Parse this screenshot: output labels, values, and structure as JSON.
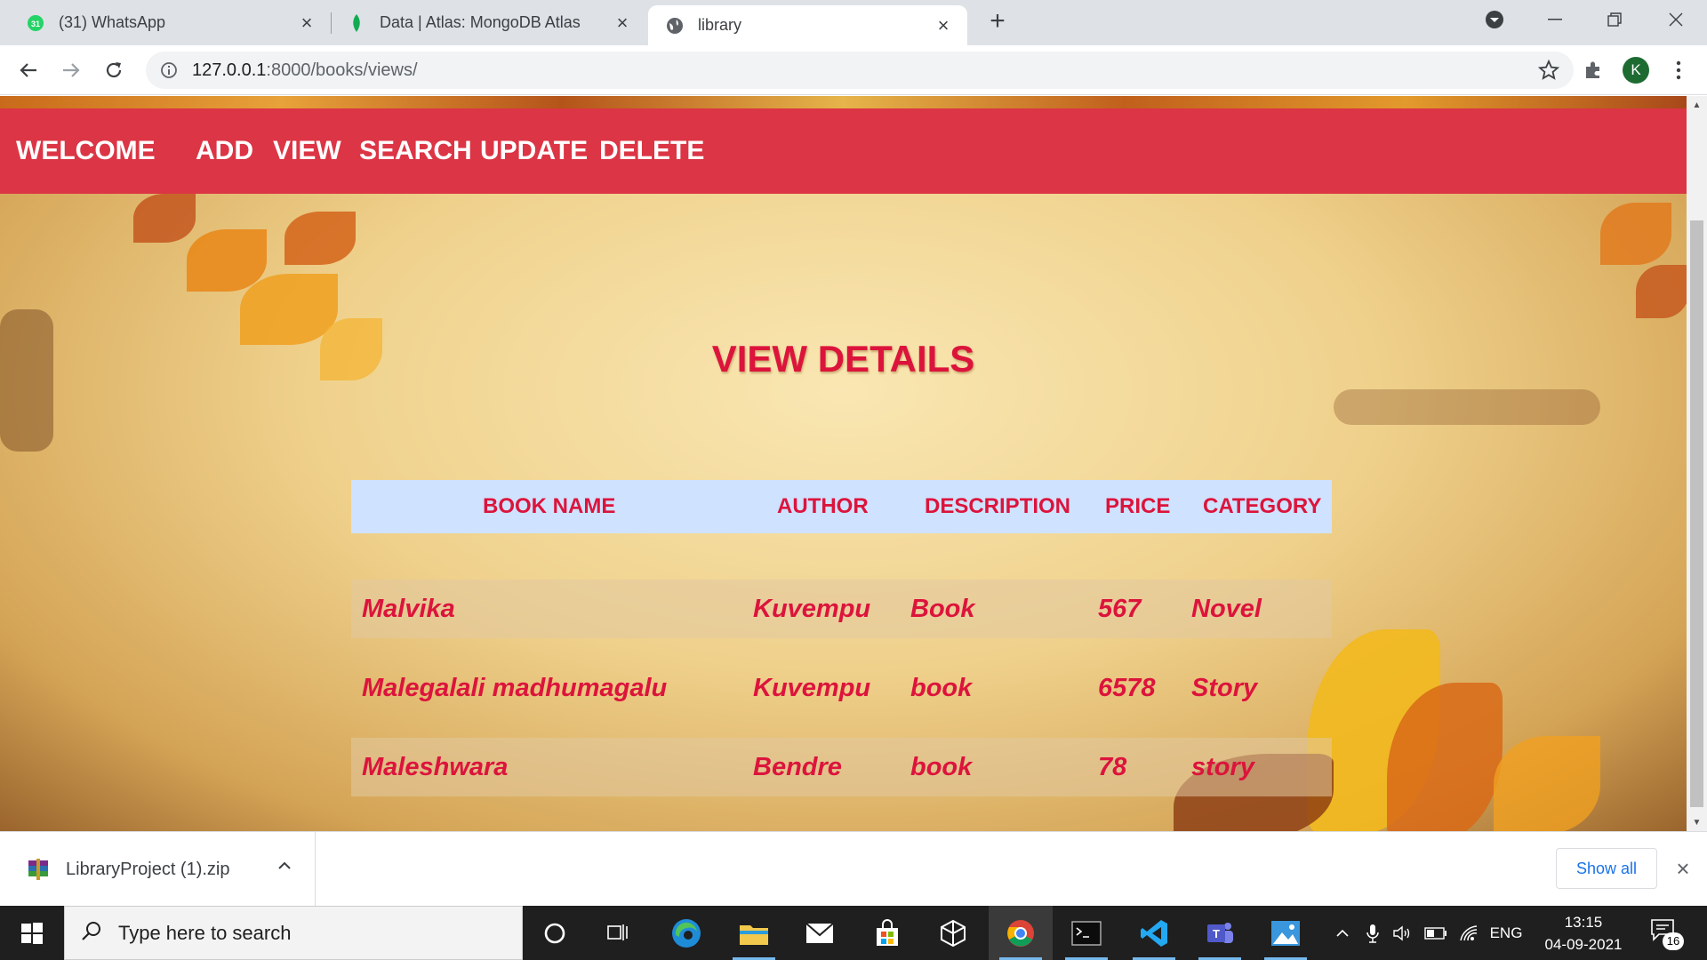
{
  "browser": {
    "tabs": [
      {
        "title": "(31) WhatsApp",
        "favicon": "whatsapp-icon",
        "badge": "31"
      },
      {
        "title": "Data | Atlas: MongoDB Atlas",
        "favicon": "mongodb-leaf-icon"
      },
      {
        "title": "library",
        "favicon": "globe-icon",
        "active": true
      }
    ],
    "url_host": "127.0.0.1",
    "url_path": ":8000/books/views/",
    "profile_initial": "K"
  },
  "page": {
    "nav": {
      "welcome": "WELCOME",
      "add": "ADD",
      "view": "VIEW",
      "search": "SEARCH",
      "update": "UPDATE",
      "delete": "DELETE"
    },
    "heading": "VIEW DETAILS",
    "table": {
      "headers": [
        "BOOK NAME",
        "AUTHOR",
        "DESCRIPTION",
        "PRICE",
        "CATEGORY"
      ],
      "rows": [
        [
          "Malvika",
          "Kuvempu",
          "Book",
          "567",
          "Novel"
        ],
        [
          "Malegalali madhumagalu",
          "Kuvempu",
          "book",
          "6578",
          "Story"
        ],
        [
          "Maleshwara",
          "Bendre",
          "book",
          "78",
          "story"
        ]
      ]
    },
    "colors": {
      "navbar": "#dc3545",
      "accent_text": "#dc143c",
      "table_header": "#cfe2ff"
    }
  },
  "downloads": {
    "file_name": "LibraryProject (1).zip",
    "show_all": "Show all"
  },
  "taskbar": {
    "search_placeholder": "Type here to search",
    "language": "ENG",
    "time": "13:15",
    "date": "04-09-2021",
    "notification_count": "16"
  }
}
